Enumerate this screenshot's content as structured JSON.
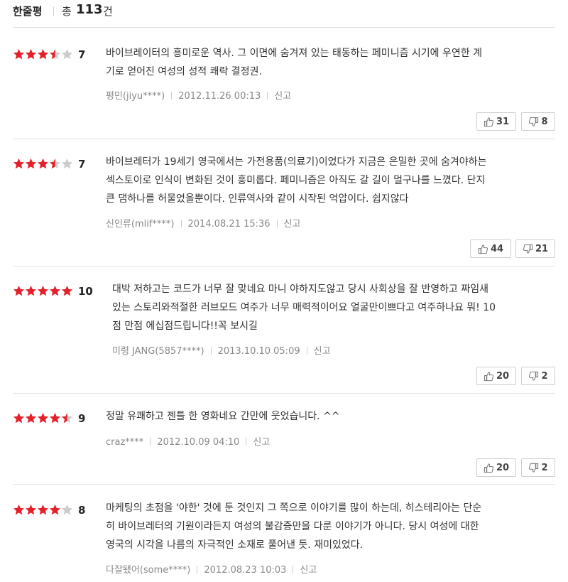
{
  "header": {
    "label": "한줄평",
    "total_prefix": "총",
    "total_count": "113",
    "total_suffix": "건"
  },
  "colors": {
    "star_filled": "#e5202a",
    "star_empty": "#cccccc"
  },
  "reviews": [
    {
      "score": "7",
      "rating": 3.5,
      "lines": [
        "바이브레이터의 흥미로운 역사. 그 이면에 숨겨져 있는 태동하는 페미니즘 시기에 우연한 계",
        "기로 얻어진 여성의 성적 쾌락 결정권."
      ],
      "author": "평민(jiyu****)",
      "date": "2012.11.26 00:13",
      "report": "신고",
      "likes": "31",
      "dislikes": "8"
    },
    {
      "score": "7",
      "rating": 3.5,
      "lines": [
        "바이브레터가 19세기 영국에서는 가전용품(의료기)이었다가 지금은 은밀한 곳에 숨겨야하는",
        "섹스토이로 인식이 변화된 것이 흥미롭다. 페미니즘은 아직도 갈 길이 멀구나를 느꼈다. 단지",
        "큰 댐하나를 허물었을뿐이다. 인류역사와 같이 시작된 억압이다. 쉽지않다"
      ],
      "author": "신인류(mlif****)",
      "date": "2014.08.21 15:36",
      "report": "신고",
      "likes": "44",
      "dislikes": "21"
    },
    {
      "score": "10",
      "rating": 5,
      "lines": [
        "대박 저하고는 코드가 너무 잘 맞네요 마니 야하지도않고 당시 사회상을 잘 반영하고 짜임새",
        "있는 스토리와적절한 러브모드 여주가 너무 매력적이어요 얼굴만이쁘다고 여주하나요 뭐! 10",
        "점 만점 에십점드립니다!!꼭 보시길"
      ],
      "author": "미령 JANG(5857****)",
      "date": "2013.10.10 05:09",
      "report": "신고",
      "likes": "20",
      "dislikes": "2"
    },
    {
      "score": "9",
      "rating": 4.5,
      "lines": [
        "정말 유쾌하고 젠틀 한 영화네요 간만에 웃었습니다. ^^"
      ],
      "author": "craz****",
      "date": "2012.10.09 04:10",
      "report": "신고",
      "likes": "20",
      "dislikes": "2"
    },
    {
      "score": "8",
      "rating": 4,
      "lines": [
        "마케팅의 초점을 '야한' 것에 둔 것인지 그 쪽으로 이야기를 많이 하는데, 히스테리아는 단순",
        "히 바이브레터의 기원이라든지 여성의 불감증만을 다룬 이야기가 아니다. 당시 여성에 대한",
        "영국의 시각을 나름의 자극적인 소재로 풀어낸 듯. 재미있었다."
      ],
      "author": "다잘됐어(some****)",
      "date": "2012.08.23 10:03",
      "report": "신고"
    }
  ]
}
